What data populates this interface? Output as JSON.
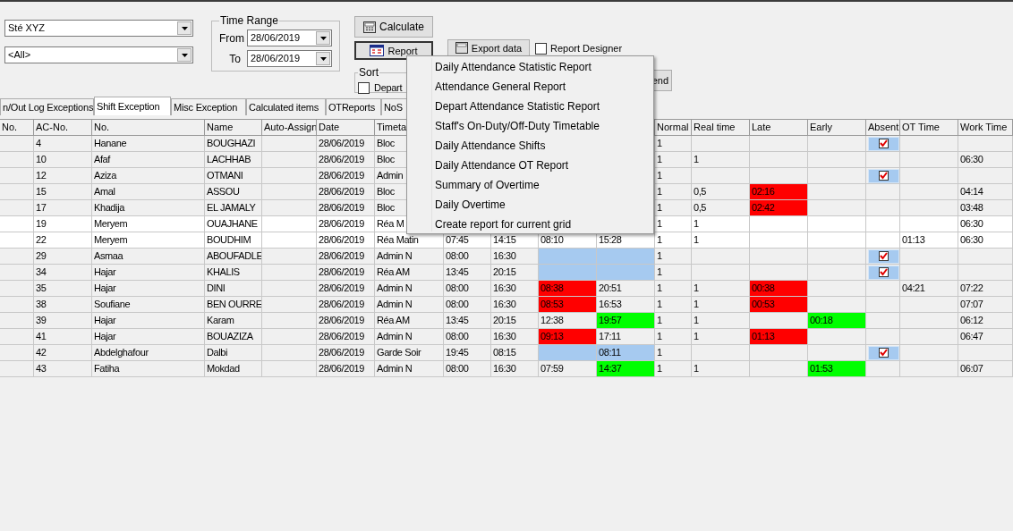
{
  "company_select": {
    "value": "Sté XYZ"
  },
  "department_select": {
    "value": "<All>"
  },
  "time_range": {
    "title": "Time Range",
    "from_label": "From",
    "from": "28/06/2019",
    "to_label": "To",
    "to": "28/06/2019"
  },
  "buttons": {
    "calculate": "Calculate",
    "report": "Report",
    "export": "Export data"
  },
  "report_designer": {
    "label": "Report Designer",
    "checked": false
  },
  "sort": {
    "title": "Sort",
    "option": {
      "label": "Depart",
      "checked": false
    }
  },
  "end_button": "end",
  "tabs": [
    {
      "label": "n/Out Log Exceptions",
      "selected": false
    },
    {
      "label": "Shift Exception",
      "selected": true
    },
    {
      "label": "Misc Exception",
      "selected": false
    },
    {
      "label": "Calculated items",
      "selected": false
    },
    {
      "label": "OTReports",
      "selected": false
    },
    {
      "label": "NoS",
      "selected": false
    }
  ],
  "table": {
    "columns": [
      "No.",
      "AC-No.",
      "No.",
      "Name",
      "Auto-Assign",
      "Date",
      "Timeta",
      null,
      null,
      null,
      null,
      "Normal",
      "Real time",
      "Late",
      "Early",
      "Absent",
      "OT Time",
      "Work Time"
    ],
    "rows": [
      {
        "selected": false,
        "cells": [
          null,
          "4",
          "Hanane",
          "BOUGHAZI",
          null,
          "28/06/2019",
          "Bloc",
          null,
          null,
          null,
          null,
          "1",
          null,
          null,
          null,
          {
            "kind": "checkbox",
            "checked": true
          },
          null,
          null
        ]
      },
      {
        "selected": false,
        "cells": [
          null,
          "10",
          "Afaf",
          "LACHHAB",
          null,
          "28/06/2019",
          "Bloc",
          null,
          null,
          null,
          null,
          "1",
          "1",
          null,
          null,
          null,
          null,
          "06:30"
        ]
      },
      {
        "selected": false,
        "cells": [
          null,
          "12",
          "Aziza",
          "OTMANI",
          null,
          "28/06/2019",
          "Admin",
          null,
          null,
          null,
          null,
          "1",
          null,
          null,
          null,
          {
            "kind": "checkbox",
            "checked": true
          },
          null,
          null
        ]
      },
      {
        "selected": false,
        "cells": [
          null,
          "15",
          "Amal",
          "ASSOU",
          null,
          "28/06/2019",
          "Bloc",
          null,
          null,
          null,
          null,
          "1",
          "0,5",
          {
            "text": "02:16",
            "color": "#ff0000"
          },
          null,
          null,
          null,
          "04:14"
        ]
      },
      {
        "selected": false,
        "cells": [
          null,
          "17",
          "Khadija",
          "EL JAMALY",
          null,
          "28/06/2019",
          "Bloc",
          null,
          null,
          null,
          null,
          "1",
          "0,5",
          {
            "text": "02:42",
            "color": "#ff0000"
          },
          null,
          null,
          null,
          "03:48"
        ]
      },
      {
        "selected": true,
        "cells": [
          null,
          "19",
          "Meryem",
          "OUAJHANE",
          null,
          "28/06/2019",
          "Réa M",
          null,
          null,
          null,
          null,
          "1",
          "1",
          null,
          null,
          null,
          null,
          "06:30"
        ]
      },
      {
        "selected": true,
        "cells": [
          null,
          "22",
          "Meryem",
          "BOUDHIM",
          null,
          "28/06/2019",
          "Réa Matin",
          "07:45",
          "14:15",
          "08:10",
          "15:28",
          "1",
          "1",
          null,
          null,
          null,
          "01:13",
          "06:30"
        ]
      },
      {
        "selected": false,
        "cells": [
          null,
          "29",
          "Asmaa",
          "ABOUFADLE",
          null,
          "28/06/2019",
          "Admin N",
          "08:00",
          "16:30",
          {
            "color": "#a6caf0"
          },
          {
            "color": "#a6caf0"
          },
          "1",
          null,
          null,
          null,
          {
            "kind": "checkbox",
            "checked": true
          },
          null,
          null
        ]
      },
      {
        "selected": false,
        "cells": [
          null,
          "34",
          "Hajar",
          "KHALIS",
          null,
          "28/06/2019",
          "Réa AM",
          "13:45",
          "20:15",
          {
            "color": "#a6caf0"
          },
          {
            "color": "#a6caf0"
          },
          "1",
          null,
          null,
          null,
          {
            "kind": "checkbox",
            "checked": true
          },
          null,
          null
        ]
      },
      {
        "selected": false,
        "cells": [
          null,
          "35",
          "Hajar",
          "DINI",
          null,
          "28/06/2019",
          "Admin N",
          "08:00",
          "16:30",
          {
            "text": "08:38",
            "color": "#ff0000"
          },
          "20:51",
          "1",
          "1",
          {
            "text": "00:38",
            "color": "#ff0000"
          },
          null,
          null,
          "04:21",
          "07:22"
        ]
      },
      {
        "selected": false,
        "cells": [
          null,
          "38",
          "Soufiane",
          "BEN OURRE",
          null,
          "28/06/2019",
          "Admin N",
          "08:00",
          "16:30",
          {
            "text": "08:53",
            "color": "#ff0000"
          },
          "16:53",
          "1",
          "1",
          {
            "text": "00:53",
            "color": "#ff0000"
          },
          null,
          null,
          null,
          "07:07"
        ]
      },
      {
        "selected": false,
        "cells": [
          null,
          "39",
          "Hajar",
          "Karam",
          null,
          "28/06/2019",
          "Réa AM",
          "13:45",
          "20:15",
          "12:38",
          {
            "text": "19:57",
            "color": "#00ff00"
          },
          "1",
          "1",
          null,
          {
            "text": "00:18",
            "color": "#00ff00"
          },
          null,
          null,
          "06:12"
        ]
      },
      {
        "selected": false,
        "cells": [
          null,
          "41",
          "Hajar",
          "BOUAZIZA",
          null,
          "28/06/2019",
          "Admin N",
          "08:00",
          "16:30",
          {
            "text": "09:13",
            "color": "#ff0000"
          },
          "17:11",
          "1",
          "1",
          {
            "text": "01:13",
            "color": "#ff0000"
          },
          null,
          null,
          null,
          "06:47"
        ]
      },
      {
        "selected": false,
        "cells": [
          null,
          "42",
          "Abdelghafour",
          "Dalbi",
          null,
          "28/06/2019",
          "Garde Soir",
          "19:45",
          "08:15",
          {
            "color": "#a6caf0"
          },
          {
            "text": "08:11",
            "color": "#a6caf0"
          },
          "1",
          null,
          null,
          null,
          {
            "kind": "checkbox",
            "checked": true
          },
          null,
          null
        ]
      },
      {
        "selected": false,
        "cells": [
          null,
          "43",
          "Fatiha",
          "Mokdad",
          null,
          "28/06/2019",
          "Admin N",
          "08:00",
          "16:30",
          "07:59",
          {
            "text": "14:37",
            "color": "#00ff00"
          },
          "1",
          "1",
          null,
          {
            "text": "01:53",
            "color": "#00ff00"
          },
          null,
          null,
          "06:07"
        ]
      }
    ]
  },
  "report_menu": {
    "items": [
      "Daily Attendance Statistic Report",
      "Attendance General Report",
      "Depart Attendance Statistic Report",
      "Staff's On-Duty/Off-Duty Timetable",
      "Daily Attendance Shifts",
      "Daily Attendance OT Report",
      "Summary of Overtime",
      "Daily Overtime",
      "Create report for current grid"
    ]
  }
}
